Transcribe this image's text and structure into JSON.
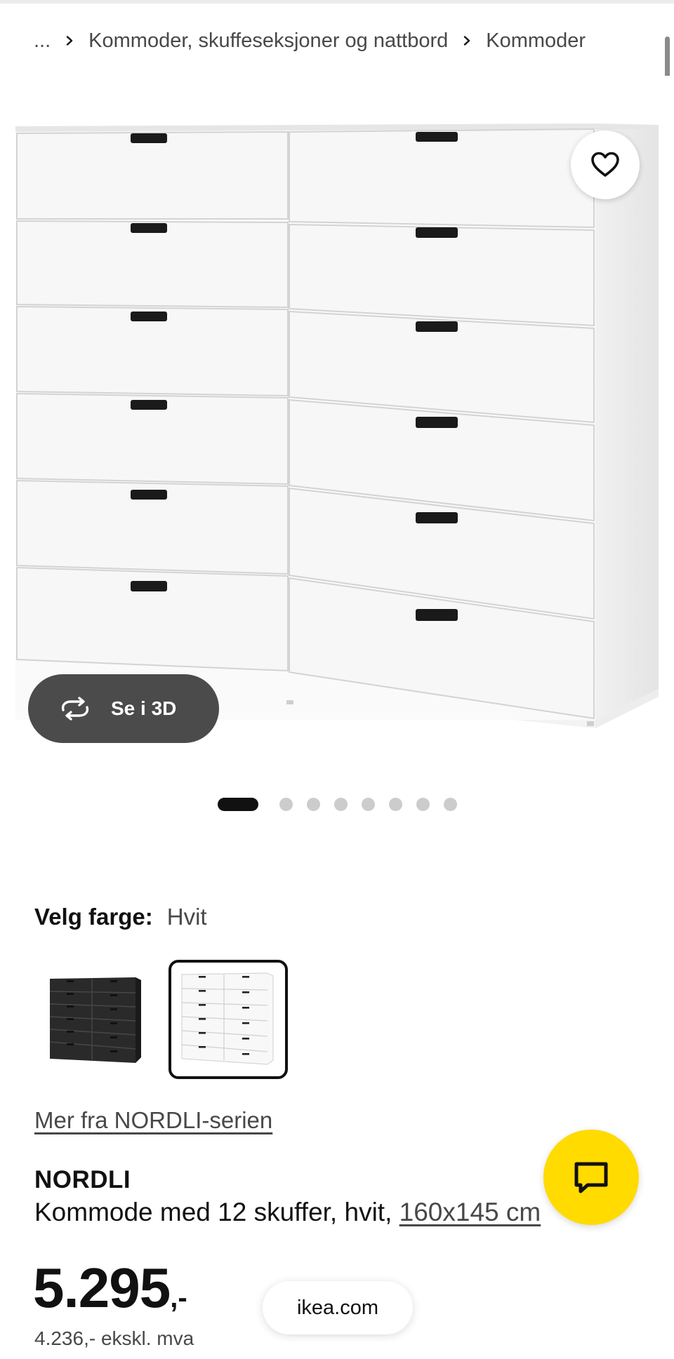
{
  "breadcrumb": {
    "items": [
      "...",
      "Kommoder, skuffeseksjoner og nattbord",
      "Kommoder"
    ]
  },
  "gallery": {
    "view_3d_label": "Se i 3D",
    "dots_total": 8,
    "dots_active": 1
  },
  "color": {
    "label": "Velg farge:",
    "value": "Hvit",
    "swatches": [
      {
        "name": "black-brown",
        "color": "#2b2b2b",
        "selected": false
      },
      {
        "name": "white",
        "color": "#ffffff",
        "selected": true
      }
    ]
  },
  "series_link": "Mer fra NORDLI-serien",
  "product": {
    "name": "NORDLI",
    "description": "Kommode med 12 skuffer, hvit, ",
    "dimensions": "160x145 cm"
  },
  "price": {
    "amount": "5.295",
    "suffix": ",-",
    "ex_vat": "4.236,- ekskl. mva"
  },
  "url_bar": {
    "text": "ikea.com"
  },
  "colors": {
    "accent_yellow": "#ffdb00",
    "text_dark": "#111111",
    "text_muted": "#484848",
    "button_dark": "#4b4b4b"
  },
  "icons": {
    "favorite": "heart-icon",
    "view_3d": "rotate-arrows-icon",
    "chat": "chat-bubble-icon",
    "breadcrumb_separator": "chevron-right-icon"
  }
}
